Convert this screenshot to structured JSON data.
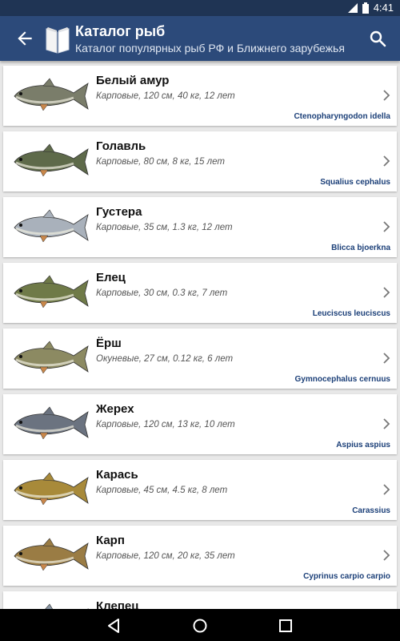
{
  "status": {
    "time": "4:41"
  },
  "header": {
    "title": "Каталог рыб",
    "subtitle": "Каталог популярных рыб РФ и Ближнего зарубежья"
  },
  "items": [
    {
      "name": "Белый амур",
      "meta": "Карповые, 120 см, 40 кг, 12 лет",
      "latin": "Ctenopharyngodon idella",
      "color": "#7a7d6a"
    },
    {
      "name": "Голавль",
      "meta": "Карповые, 80 см, 8 кг, 15 лет",
      "latin": "Squalius cephalus",
      "color": "#5e6a4a"
    },
    {
      "name": "Густера",
      "meta": "Карповые, 35 см, 1.3 кг, 12 лет",
      "latin": "Blicca bjoerkna",
      "color": "#a9b1bb"
    },
    {
      "name": "Елец",
      "meta": "Карповые, 30 см, 0.3 кг, 7 лет",
      "latin": "Leuciscus leuciscus",
      "color": "#6f7a48"
    },
    {
      "name": "Ёрш",
      "meta": "Окуневые, 27 см, 0.12 кг, 6 лет",
      "latin": "Gymnocephalus cernuus",
      "color": "#8c8a62"
    },
    {
      "name": "Жерех",
      "meta": "Карповые, 120 см, 13 кг, 10 лет",
      "latin": "Aspius aspius",
      "color": "#6b7380"
    },
    {
      "name": "Карась",
      "meta": "Карповые, 45 см, 4.5 кг, 8 лет",
      "latin": "Carassius",
      "color": "#a88a3a"
    },
    {
      "name": "Карп",
      "meta": "Карповые, 120 см, 20 кг, 35 лет",
      "latin": "Cyprinus carpio carpio",
      "color": "#9a7c44"
    },
    {
      "name": "Клепец",
      "meta": "",
      "latin": "",
      "color": "#8c98a6"
    }
  ]
}
